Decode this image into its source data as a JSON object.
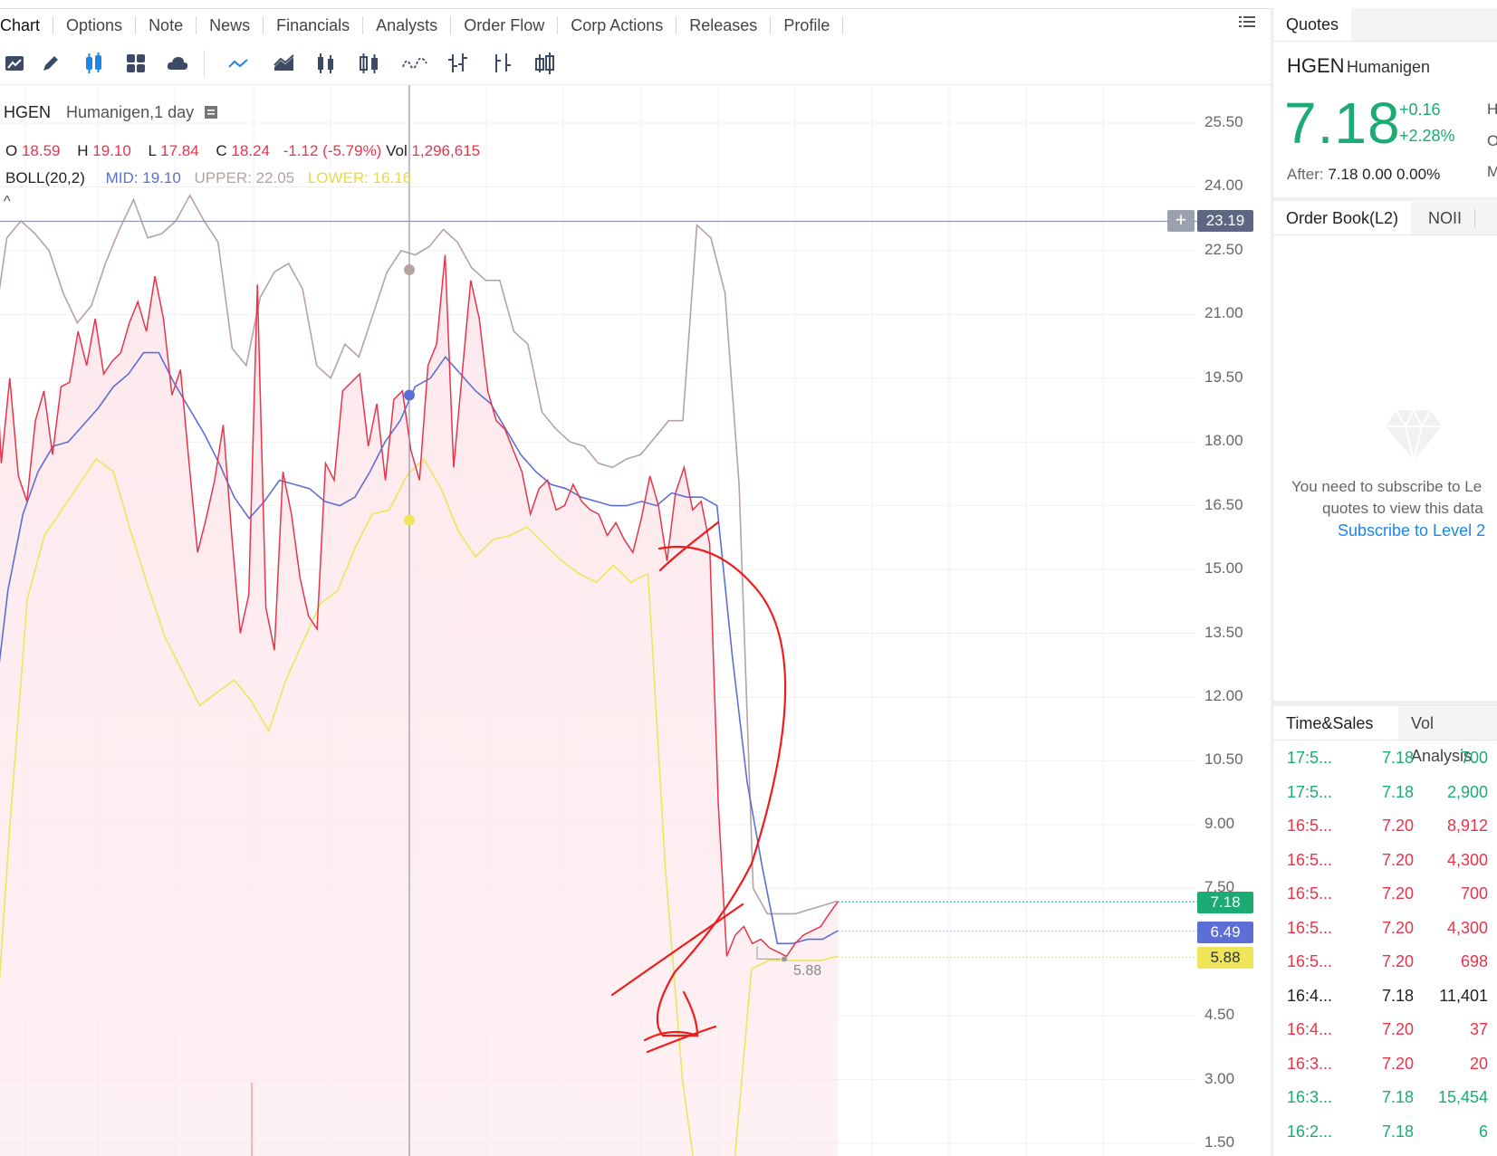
{
  "tabs": [
    "Chart",
    "Options",
    "Note",
    "News",
    "Financials",
    "Analysts",
    "Order Flow",
    "Corp Actions",
    "Releases",
    "Profile"
  ],
  "toolbar_icons": [
    "drawing-icon",
    "pen-icon",
    "indicator-icon",
    "layout-icon",
    "cloud-icon",
    "line-chart-icon",
    "area-chart-icon",
    "candle-chart-icon",
    "hollow-candle-icon",
    "wave-chart-icon",
    "ohlc-bar-icon",
    "hlc-bar-icon",
    "volume-candle-icon"
  ],
  "overlay": {
    "symbol": "HGEN",
    "desc": "Humanigen,1 day",
    "o_label": "O",
    "o_val": "18.59",
    "h_label": "H",
    "h_val": "19.10",
    "l_label": "L",
    "l_val": "17.84",
    "c_label": "C",
    "c_val": "18.24",
    "change": "-1.12 (-5.79%)",
    "vol_label": "Vol",
    "vol_val": "1,296,615",
    "boll_label": "BOLL(20,2)",
    "mid_label": "MID:",
    "mid_val": "19.10",
    "upper_label": "UPPER:",
    "upper_val": "22.05",
    "lower_label": "LOWER:",
    "lower_val": "16.16",
    "collapse": "^"
  },
  "chart_data": {
    "type": "line",
    "symbol": "HGEN",
    "ylim": [
      1.5,
      25.5
    ],
    "y_ticks": [
      "25.50",
      "24.00",
      "22.50",
      "21.00",
      "19.50",
      "18.00",
      "16.50",
      "15.00",
      "13.50",
      "12.00",
      "10.50",
      "9.00",
      "7.50",
      "4.50",
      "3.00",
      "1.50"
    ],
    "crosshair_price": "23.19",
    "last_price_tag": "7.18",
    "mid_tag": "6.49",
    "lower_tag": "5.88",
    "low_marker": "5.88",
    "colors": {
      "price": "#e8344a",
      "upper": "#b5a2a2",
      "mid": "#5d6fd6",
      "lower": "#eee55a",
      "fill": "#fde8ec"
    },
    "series": [
      {
        "name": "close",
        "values": [
          21.5,
          17.5,
          19.5,
          17.2,
          16.6,
          18.5,
          19.2,
          17.7,
          19.3,
          19.4,
          20.6,
          19.8,
          20.9,
          19.6,
          19.9,
          20.1,
          20.8,
          21.3,
          20.6,
          21.9,
          20.9,
          19.1,
          19.7,
          17.5,
          15.4,
          16.2,
          17.1,
          18.4,
          15.8,
          13.5,
          14.4,
          21.7,
          14.1,
          13.1,
          17.3,
          16.3,
          14.8,
          13.9,
          13.6,
          17.5,
          17.1,
          19.2,
          19.4,
          19.6,
          17.9,
          18.9,
          17.1,
          19.0,
          19.2,
          17.8,
          17.1,
          19.8,
          20.3,
          22.4,
          17.4,
          19.6,
          21.8,
          20.9,
          19.2,
          18.5,
          18.3,
          17.8,
          17.3,
          16.3,
          16.9,
          17.1,
          16.4,
          16.5,
          17.0,
          16.6,
          16.4,
          16.3,
          15.8,
          16.1,
          15.7,
          15.4,
          16.2,
          17.2,
          16.5,
          15.2,
          16.8,
          17.4,
          16.4,
          16.6,
          15.6,
          9.5,
          5.9,
          6.4,
          6.6,
          6.2,
          6.3,
          6.1,
          6.0,
          5.9,
          6.2,
          6.4,
          6.5,
          6.6,
          6.9,
          7.18
        ]
      },
      {
        "name": "upper",
        "values": [
          20.5,
          22.8,
          23.2,
          22.9,
          22.5,
          21.5,
          20.8,
          21.2,
          22.2,
          23.0,
          23.7,
          22.8,
          22.9,
          23.2,
          23.8,
          23.2,
          22.7,
          20.2,
          19.8,
          21.4,
          22.0,
          22.2,
          21.6,
          19.8,
          19.5,
          20.3,
          20.0,
          21.0,
          22.0,
          22.5,
          22.4,
          22.6,
          23.0,
          22.7,
          22.1,
          21.8,
          21.8,
          20.6,
          20.3,
          18.7,
          18.3,
          18.0,
          17.9,
          17.5,
          17.4,
          17.6,
          17.7,
          18.1,
          18.5,
          18.5,
          23.1,
          22.8,
          21.5,
          17.0,
          7.5,
          6.9,
          6.9,
          6.9,
          7.0,
          7.1,
          7.2
        ]
      },
      {
        "name": "mid",
        "values": [
          11.5,
          14.5,
          16.3,
          17.3,
          17.9,
          18.0,
          18.4,
          18.8,
          19.3,
          19.6,
          20.1,
          20.1,
          19.4,
          18.8,
          18.2,
          17.5,
          16.7,
          16.2,
          16.6,
          17.1,
          17.0,
          16.9,
          16.6,
          16.5,
          16.7,
          17.3,
          18.0,
          18.5,
          19.3,
          19.5,
          20.0,
          19.6,
          19.2,
          18.9,
          18.3,
          17.7,
          17.3,
          17.0,
          16.9,
          16.7,
          16.6,
          16.5,
          16.5,
          16.6,
          16.5,
          16.8,
          16.7,
          16.7,
          16.5,
          13.0,
          10.0,
          8.0,
          6.2,
          6.2,
          6.3,
          6.3,
          6.5
        ]
      },
      {
        "name": "lower",
        "values": [
          3.0,
          9.0,
          14.3,
          15.8,
          16.4,
          17.0,
          17.6,
          17.3,
          15.9,
          14.6,
          13.4,
          12.6,
          11.8,
          12.1,
          12.4,
          11.9,
          11.2,
          12.4,
          13.3,
          14.2,
          14.5,
          15.5,
          16.3,
          16.4,
          17.2,
          17.6,
          16.9,
          15.9,
          15.3,
          15.7,
          15.8,
          16.0,
          15.6,
          15.2,
          14.9,
          14.7,
          15.1,
          14.7,
          14.9,
          8.0,
          3.0,
          0.0,
          0.0,
          1.0,
          5.6,
          5.8,
          5.8,
          5.8,
          5.8,
          5.9
        ]
      }
    ]
  },
  "quotes": {
    "tab": "Quotes",
    "symbol": "HGEN",
    "name": "Humanigen",
    "price": "7.18",
    "change": "+0.16",
    "change_pct": "+2.28%",
    "right_letters": [
      "H",
      "O",
      "M"
    ],
    "after_label": "After:",
    "after_vals": "7.18 0.00 0.00%"
  },
  "orderbook": {
    "tab": "Order Book(L2)",
    "tab2": "NOII",
    "msg1": "You need to subscribe to Le",
    "msg2": "quotes to view this data",
    "link": "Subscribe to Level 2"
  },
  "timesales": {
    "tab": "Time&Sales",
    "tab2": "Vol Analysis",
    "rows": [
      {
        "time": "17:5...",
        "price": "7.18",
        "size": "700",
        "c": "grn"
      },
      {
        "time": "17:5...",
        "price": "7.18",
        "size": "2,900",
        "c": "grn"
      },
      {
        "time": "16:5...",
        "price": "7.20",
        "size": "8,912",
        "c": "red"
      },
      {
        "time": "16:5...",
        "price": "7.20",
        "size": "4,300",
        "c": "red"
      },
      {
        "time": "16:5...",
        "price": "7.20",
        "size": "700",
        "c": "red"
      },
      {
        "time": "16:5...",
        "price": "7.20",
        "size": "4,300",
        "c": "red"
      },
      {
        "time": "16:5...",
        "price": "7.20",
        "size": "698",
        "c": "red"
      },
      {
        "time": "16:4...",
        "price": "7.18",
        "size": "11,401",
        "c": "blk"
      },
      {
        "time": "16:4...",
        "price": "7.20",
        "size": "37",
        "c": "red"
      },
      {
        "time": "16:3...",
        "price": "7.20",
        "size": "20",
        "c": "red"
      },
      {
        "time": "16:3...",
        "price": "7.18",
        "size": "15,454",
        "c": "grn"
      },
      {
        "time": "16:2...",
        "price": "7.18",
        "size": "6",
        "c": "grn"
      }
    ]
  }
}
